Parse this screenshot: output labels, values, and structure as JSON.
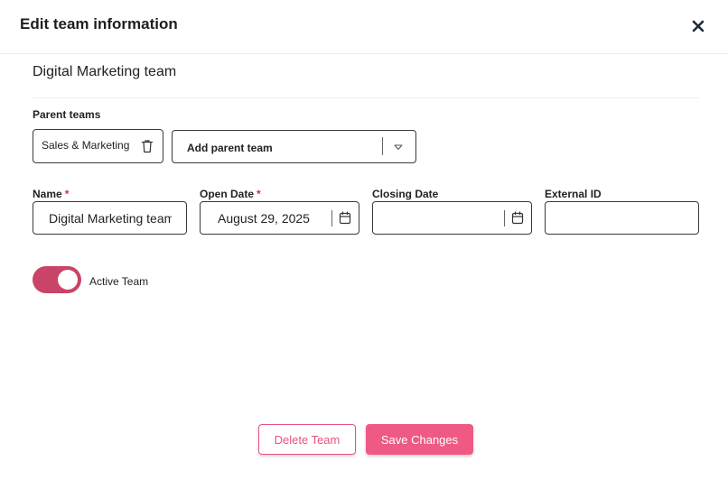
{
  "dialog": {
    "title": "Edit team information",
    "team_name_heading": "Digital Marketing team"
  },
  "parent_teams": {
    "label": "Parent teams",
    "chips": [
      {
        "label": "Sales & Marketing"
      }
    ],
    "select": {
      "placeholder": "Add parent team"
    }
  },
  "fields": {
    "name": {
      "label": "Name",
      "required_mark": "*",
      "value": "Digital Marketing team"
    },
    "open_date": {
      "label": "Open Date",
      "required_mark": "*",
      "value": "August 29, 2025"
    },
    "closing_date": {
      "label": "Closing Date",
      "value": ""
    },
    "external_id": {
      "label": "External ID",
      "value": ""
    }
  },
  "active_toggle": {
    "label": "Active Team",
    "on": true
  },
  "actions": {
    "delete_label": "Delete Team",
    "save_label": "Save Changes"
  },
  "colors": {
    "accent": "#ef5a84",
    "toggle_on": "#c94466",
    "required": "#e0273d"
  },
  "icons": {
    "close": "close-icon",
    "trash": "trash-icon",
    "dropdown": "chevron-down-icon",
    "calendar": "calendar-icon"
  }
}
